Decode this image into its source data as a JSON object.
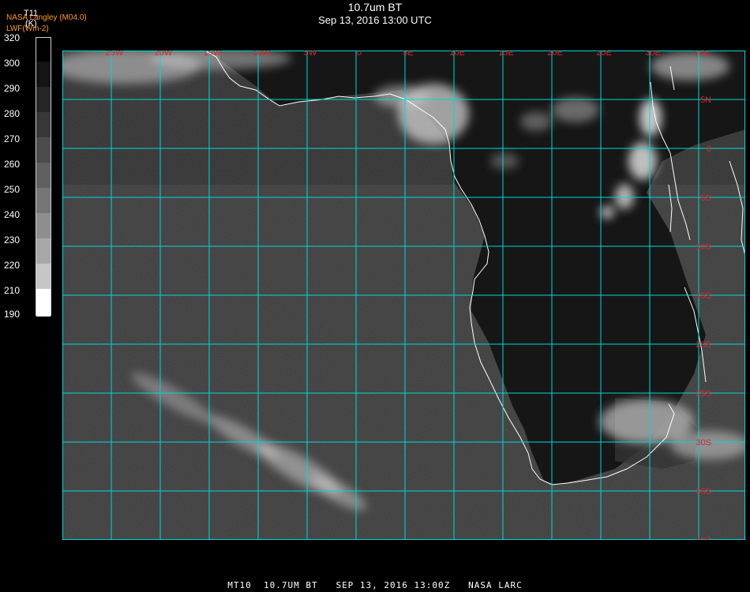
{
  "header": {
    "title": "10.7um BT",
    "subtitle": "Sep 13, 2016 13:00 UTC",
    "credit_line1": "NASA Langley (M04.0)",
    "credit_line2": "LWF(Wm-2)"
  },
  "colorbar": {
    "variable": "T11",
    "unit": "(K)",
    "ticks": [
      "320",
      "300",
      "290",
      "280",
      "270",
      "260",
      "250",
      "240",
      "230",
      "220",
      "210",
      "190"
    ]
  },
  "map": {
    "lon_labels": [
      "25W",
      "20W",
      "15W",
      "10W",
      "5W",
      "0",
      "5E",
      "10E",
      "15E",
      "20E",
      "25E",
      "30E",
      "35E"
    ],
    "lat_labels": [
      "5N",
      "0",
      "5S",
      "10S",
      "15S",
      "20S",
      "25S",
      "30S",
      "35S",
      "40S"
    ],
    "grid_color": "#00d8d8",
    "label_color": "#e0252a",
    "coast_color": "#ffffff"
  },
  "footer": {
    "text": "MT10  10.7UM BT   SEP 13, 2016 13:00Z   NASA LARC"
  }
}
